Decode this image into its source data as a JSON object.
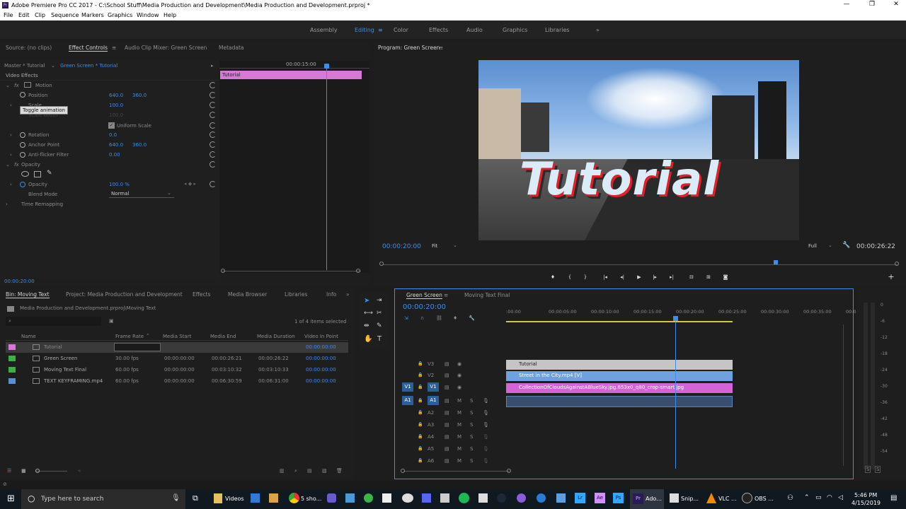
{
  "window": {
    "title": "Adobe Premiere Pro CC 2017 - C:\\School Stuff\\Media Production and Development\\Media Production and Development.prproj *",
    "icon": "Pr",
    "controls": [
      "—",
      "❐",
      "✕"
    ]
  },
  "menu": [
    "File",
    "Edit",
    "Clip",
    "Sequence",
    "Markers",
    "Graphics",
    "Window",
    "Help"
  ],
  "workspaces": [
    "Assembly",
    "Editing",
    "Color",
    "Effects",
    "Audio",
    "Graphics",
    "Libraries"
  ],
  "workspace_active": "Editing",
  "workspace_more": "»",
  "effect_controls": {
    "tabs": [
      "Source: (no clips)",
      "Effect Controls",
      "Audio Clip Mixer: Green Screen",
      "Metadata"
    ],
    "master": "Master * Tutorial",
    "clip": "Green Screen * Tutorial",
    "ruler_time": "00:00:15:00",
    "clip_bar": "Tutorial",
    "video_effects": "Video Effects",
    "motion": "Motion",
    "position_label": "Position",
    "position_x": "640.0",
    "position_y": "360.0",
    "scale_label": "Scale",
    "scale_value": "100.0",
    "scale_width_label": "Scale Width",
    "scale_width_value": "100.0",
    "uniform_scale": "Uniform Scale",
    "rotation_label": "Rotation",
    "rotation_value": "0.0",
    "anchor_label": "Anchor Point",
    "anchor_x": "640.0",
    "anchor_y": "360.0",
    "antiflicker_label": "Anti-flicker Filter",
    "antiflicker_value": "0.00",
    "opacity_section": "Opacity",
    "opacity_label": "Opacity",
    "opacity_value": "100.0 %",
    "blend_label": "Blend Mode",
    "blend_value": "Normal",
    "time_remap": "Time Remapping",
    "tooltip": "Toggle animation",
    "timecode": "00:00:20:00",
    "fx": "fx"
  },
  "program": {
    "title": "Program: Green Screen",
    "overlay_text": "Tutorial",
    "timecode": "00:00:20:00",
    "fit": "Fit",
    "quality": "Full",
    "duration": "00:00:26:22",
    "playhead": 0.764
  },
  "project": {
    "tabs": [
      "Bin: Moving Text",
      "Project: Media Production and Development",
      "Effects",
      "Media Browser",
      "Libraries",
      "Info"
    ],
    "path": "Media Production and Development.prproj\\Moving Text",
    "selection": "1 of 4 items selected",
    "columns": [
      "Name",
      "Frame Rate",
      "Media Start",
      "Media End",
      "Media Duration",
      "Video In Point"
    ],
    "rows": [
      {
        "color": "#d877d8",
        "name": "Tutorial",
        "rate": "",
        "start": "",
        "end": "",
        "duration": "",
        "in": "00:00:00:00"
      },
      {
        "color": "#3fae4a",
        "name": "Green Screen",
        "rate": "30.00 fps",
        "start": "00:00:00:00",
        "end": "00:00:26:21",
        "duration": "00:00:26:22",
        "in": "00:00:00:00"
      },
      {
        "color": "#3fae4a",
        "name": "Moving Text Final",
        "rate": "60.00 fps",
        "start": "00:00:00:00",
        "end": "00:03:10:32",
        "duration": "00:03:10:33",
        "in": "00:00:00:00"
      },
      {
        "color": "#5a8fd0",
        "name": "TEXT KEYFRAMING.mp4",
        "rate": "60.00 fps",
        "start": "00:00:00:00",
        "end": "00:06:30:59",
        "duration": "00:06:31:00",
        "in": "00:00:00:00"
      }
    ]
  },
  "timeline": {
    "tabs": [
      "Green Screen",
      "Moving Text Final"
    ],
    "timecode": "00:00:20:00",
    "ruler": [
      ":00:00",
      "00:00:05:00",
      "00:00:10:00",
      "00:00:15:00",
      "00:00:20:00",
      "00:00:25:00",
      "00:00:30:00",
      "00:00:35:00",
      "00:0"
    ],
    "tracks": [
      "V3",
      "V2",
      "V1",
      "A1",
      "A2",
      "A3",
      "A4",
      "A5",
      "A6"
    ],
    "source_v": "V1",
    "source_a": "A1",
    "clip_v3": "Tutorial",
    "clip_v2": "Street in the City.mp4 [V]",
    "clip_v1": "CollectionOfCloudsAgainstABlueSky.jpg.653x0_q80_crop-smart.jpg",
    "m": "M",
    "s": "S"
  },
  "meters": [
    "0",
    "-6",
    "-12",
    "-18",
    "-24",
    "-30",
    "-36",
    "-42",
    "-48",
    "-54"
  ],
  "meter_solo": [
    "S",
    "S"
  ],
  "taskbar": {
    "search": "Type here to search",
    "apps": [
      "Videos",
      "5 sho...",
      "Ado...",
      "Snip...",
      "VLC ...",
      "OBS ..."
    ],
    "time": "5:46 PM",
    "date": "4/15/2019"
  }
}
